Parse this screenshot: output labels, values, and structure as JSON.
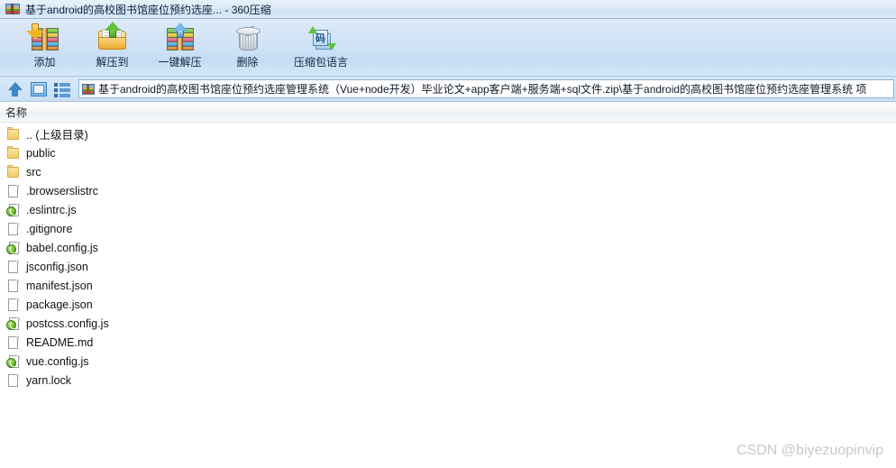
{
  "window": {
    "title": "基于android的高校图书馆座位预约选座... - 360压缩",
    "app_icon": "archive-icon"
  },
  "toolbar": {
    "buttons": [
      {
        "label": "添加",
        "icon": "add-archive-icon"
      },
      {
        "label": "解压到",
        "icon": "extract-to-folder-icon"
      },
      {
        "label": "一键解压",
        "icon": "one-click-extract-icon"
      },
      {
        "label": "删除",
        "icon": "trash-icon"
      },
      {
        "label": "压缩包语言",
        "icon": "archive-language-icon"
      }
    ]
  },
  "addressbar": {
    "nav": [
      {
        "name": "up-directory",
        "icon": "arrow-up-icon"
      },
      {
        "name": "view-panel",
        "icon": "window-icon"
      },
      {
        "name": "view-list",
        "icon": "list-icon"
      }
    ],
    "path": "基于android的高校图书馆座位预约选座管理系统（Vue+node开发）毕业论文+app客户端+服务端+sql文件.zip\\基于android的高校图书馆座位预约选座管理系统 项"
  },
  "list": {
    "columns": [
      "名称"
    ],
    "rows": [
      {
        "name": ".. (上级目录)",
        "icon": "folder-icon",
        "type": "folder"
      },
      {
        "name": "public",
        "icon": "folder-icon",
        "type": "folder"
      },
      {
        "name": "src",
        "icon": "folder-icon",
        "type": "folder"
      },
      {
        "name": ".browserslistrc",
        "icon": "file-icon",
        "type": "file"
      },
      {
        "name": ".eslintrc.js",
        "icon": "js-file-icon",
        "type": "js"
      },
      {
        "name": ".gitignore",
        "icon": "file-icon",
        "type": "file"
      },
      {
        "name": "babel.config.js",
        "icon": "js-file-icon",
        "type": "js"
      },
      {
        "name": "jsconfig.json",
        "icon": "file-icon",
        "type": "file"
      },
      {
        "name": "manifest.json",
        "icon": "file-icon",
        "type": "file"
      },
      {
        "name": "package.json",
        "icon": "file-icon",
        "type": "file"
      },
      {
        "name": "postcss.config.js",
        "icon": "js-file-icon",
        "type": "js"
      },
      {
        "name": "README.md",
        "icon": "file-icon",
        "type": "file"
      },
      {
        "name": "vue.config.js",
        "icon": "js-file-icon",
        "type": "js"
      },
      {
        "name": "yarn.lock",
        "icon": "file-icon",
        "type": "file"
      }
    ]
  },
  "watermark": "CSDN @biyezuopinvip",
  "colors": {
    "titlebar": "#d7e7f7",
    "toolbar": "#cfe2f6",
    "accent": "#3d86c9",
    "list_bg": "#ffffff",
    "watermark": "#c9c9c9"
  }
}
